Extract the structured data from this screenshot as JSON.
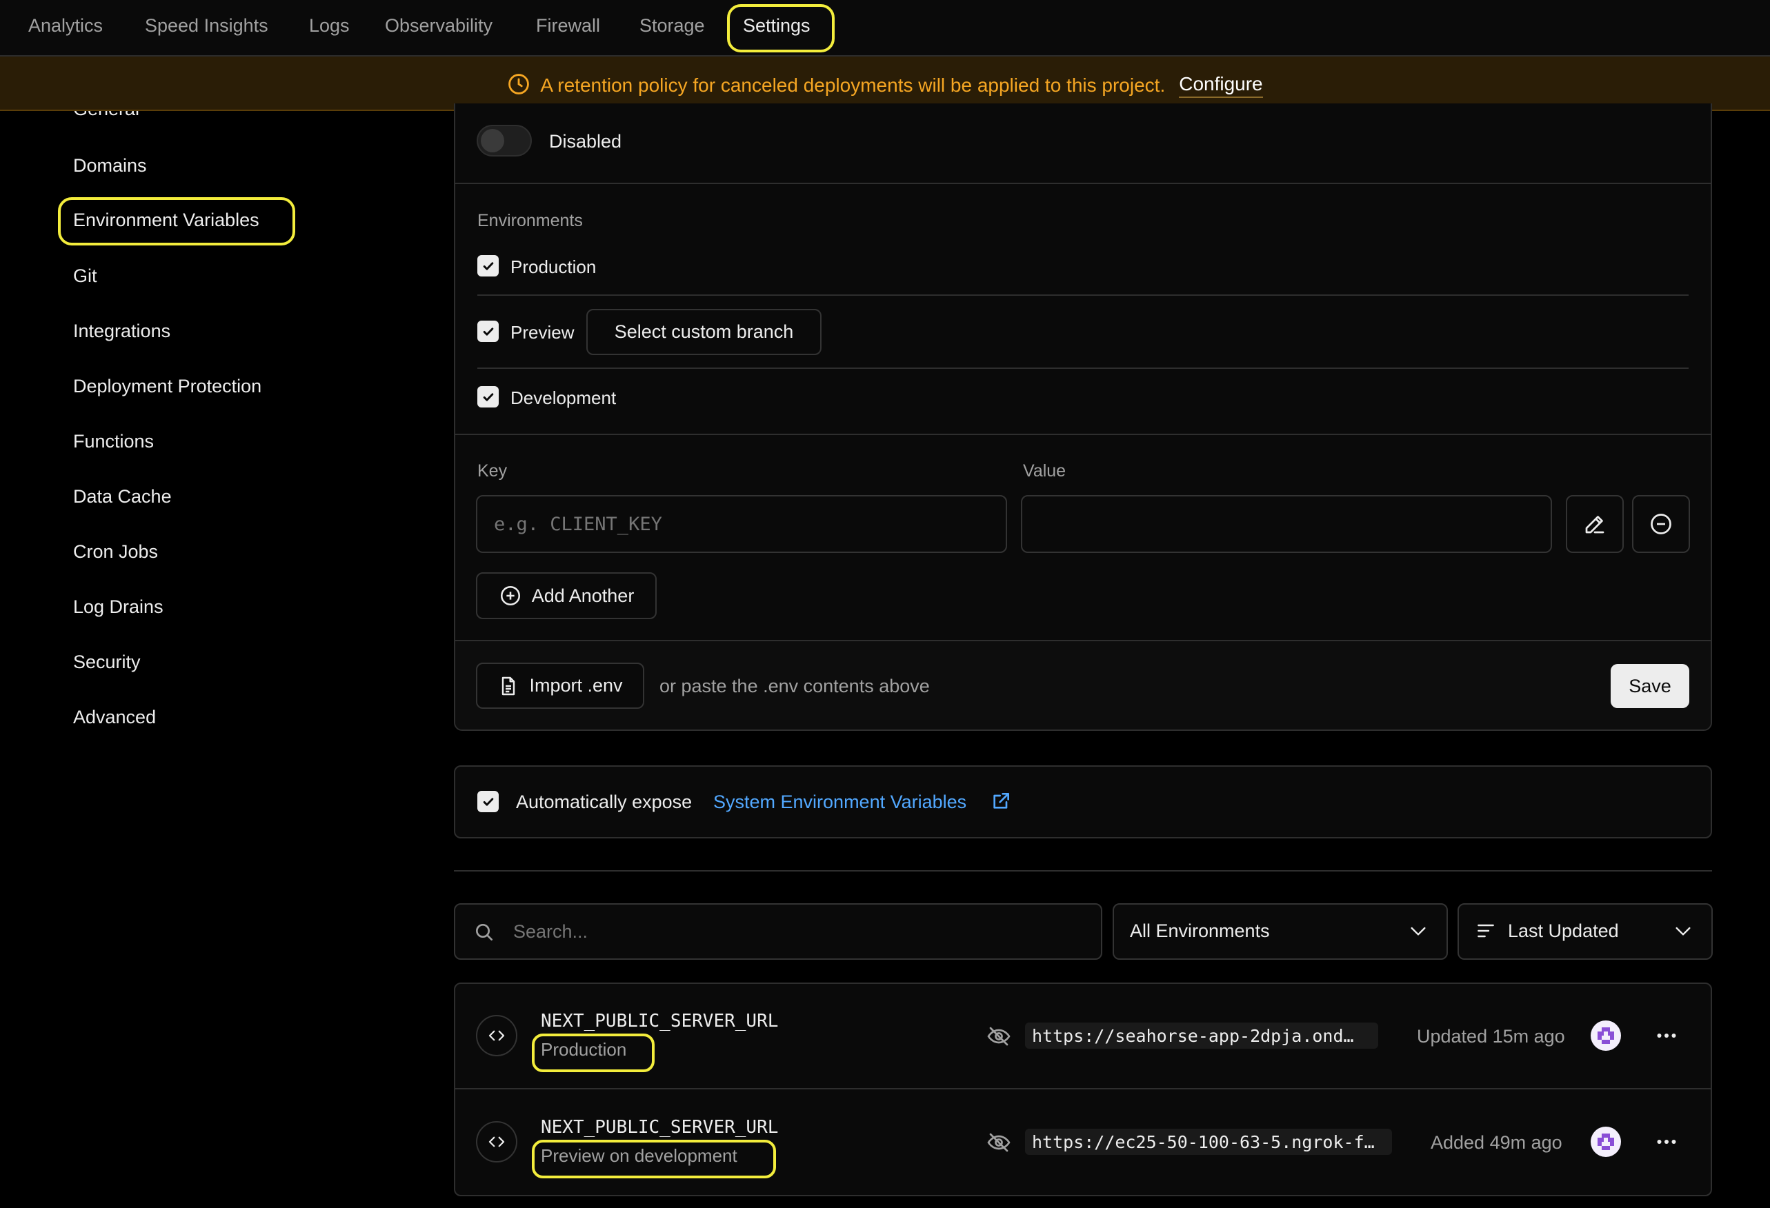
{
  "topnav": {
    "tabs": [
      {
        "label": "Analytics"
      },
      {
        "label": "Speed Insights"
      },
      {
        "label": "Logs"
      },
      {
        "label": "Observability"
      },
      {
        "label": "Firewall"
      },
      {
        "label": "Storage"
      },
      {
        "label": "Settings",
        "active": true
      }
    ]
  },
  "banner": {
    "icon": "clock-icon",
    "text": "A retention policy for canceled deployments will be applied to this project.",
    "link": "Configure"
  },
  "sidebar": {
    "items": [
      {
        "label": "General"
      },
      {
        "label": "Domains"
      },
      {
        "label": "Environment Variables",
        "active": true
      },
      {
        "label": "Git"
      },
      {
        "label": "Integrations"
      },
      {
        "label": "Deployment Protection"
      },
      {
        "label": "Functions"
      },
      {
        "label": "Data Cache"
      },
      {
        "label": "Cron Jobs"
      },
      {
        "label": "Log Drains"
      },
      {
        "label": "Security"
      },
      {
        "label": "Advanced"
      }
    ]
  },
  "form": {
    "sensitive_toggle": {
      "label": "Disabled",
      "checked": false
    },
    "environments": {
      "heading": "Environments",
      "production": {
        "label": "Production",
        "checked": true
      },
      "preview": {
        "label": "Preview",
        "checked": true,
        "branch_button": "Select custom branch"
      },
      "development": {
        "label": "Development",
        "checked": true
      }
    },
    "key": {
      "label": "Key",
      "placeholder": "e.g. CLIENT_KEY",
      "value": ""
    },
    "value": {
      "label": "Value",
      "value": ""
    },
    "add_another": "Add Another",
    "import_button": "Import .env",
    "import_hint": "or paste the .env contents above",
    "save": "Save"
  },
  "system_vars": {
    "checked": true,
    "prefix": "Automatically expose",
    "link": "System Environment Variables"
  },
  "filters": {
    "search_placeholder": "Search...",
    "environment_select": "All Environments",
    "sort_select": "Last Updated"
  },
  "env_vars": [
    {
      "name": "NEXT_PUBLIC_SERVER_URL",
      "scope": "Production",
      "value": "https://seahorse-app-2dpja.ond…",
      "status": "Updated 15m ago"
    },
    {
      "name": "NEXT_PUBLIC_SERVER_URL",
      "scope": "Preview on development",
      "value": "https://ec25-50-100-63-5.ngrok-f…",
      "status": "Added 49m ago"
    }
  ],
  "colors": {
    "accent_highlight": "#f3ed3c",
    "warning": "#f5a623",
    "link": "#52a8ff",
    "avatar": "#8a4fd6"
  }
}
